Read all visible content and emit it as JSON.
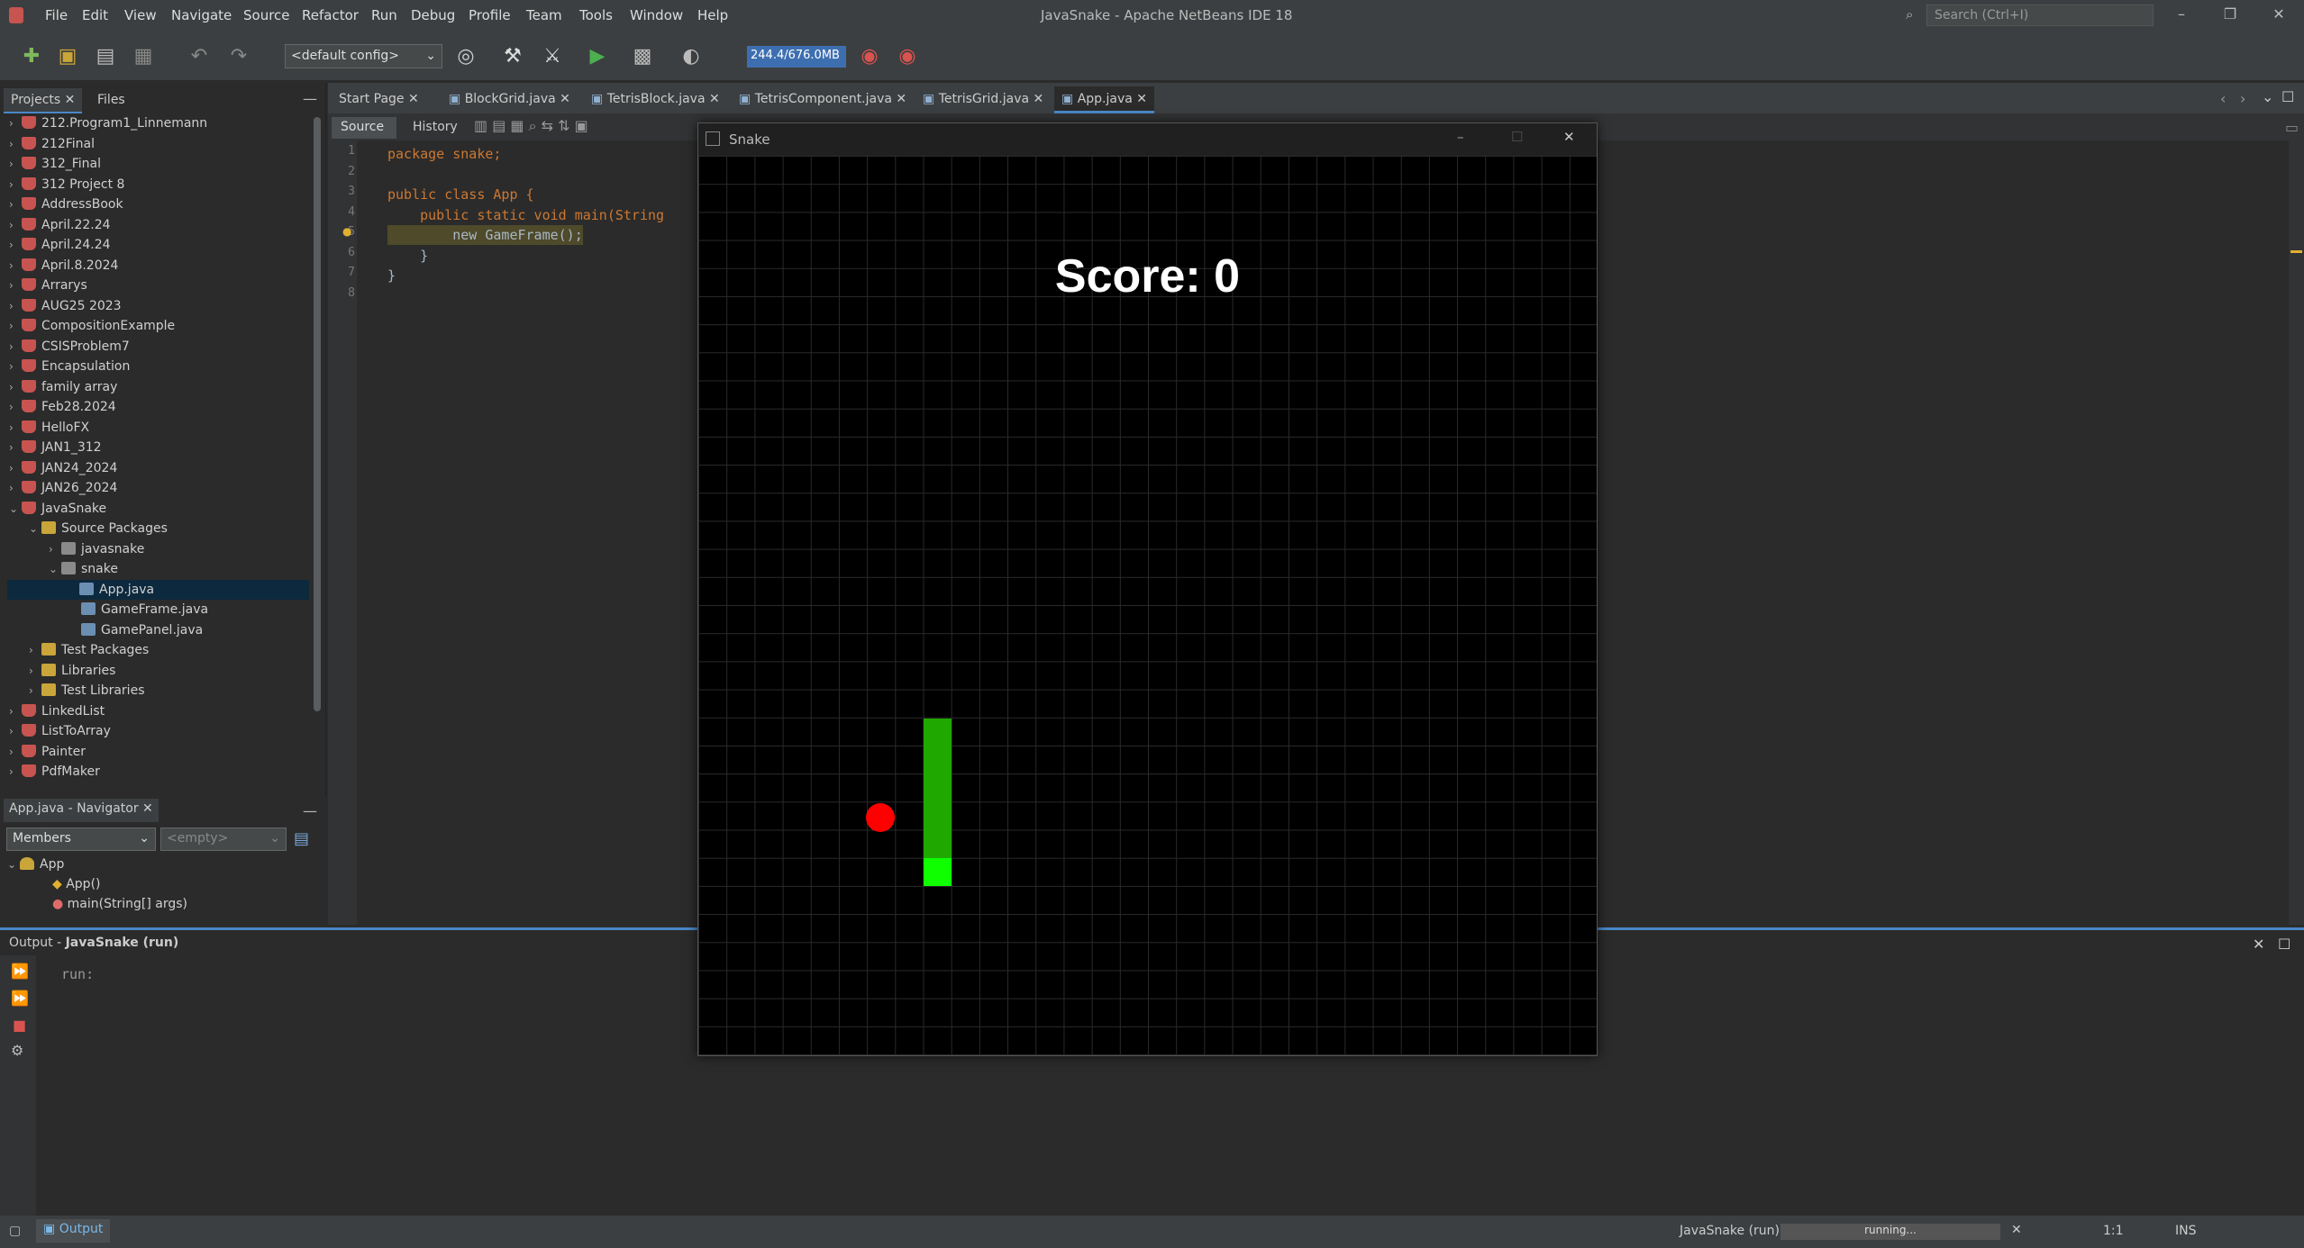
{
  "window": {
    "title": "JavaSnake - Apache NetBeans IDE 18"
  },
  "menu": [
    "File",
    "Edit",
    "View",
    "Navigate",
    "Source",
    "Refactor",
    "Run",
    "Debug",
    "Profile",
    "Team",
    "Tools",
    "Window",
    "Help"
  ],
  "search": {
    "placeholder": "Search (Ctrl+I)"
  },
  "toolbar": {
    "config": "<default config>",
    "memory": "244.4/676.0MB"
  },
  "projects_panel": {
    "tabs": [
      "Projects",
      "Files"
    ],
    "items": [
      {
        "label": "212.Program1_Linnemann",
        "icon": "project-icon"
      },
      {
        "label": "212Final",
        "icon": "project-icon"
      },
      {
        "label": "312_Final",
        "icon": "project-icon"
      },
      {
        "label": "312 Project 8",
        "icon": "project-icon"
      },
      {
        "label": "AddressBook",
        "icon": "project-icon"
      },
      {
        "label": "April.22.24",
        "icon": "project-icon"
      },
      {
        "label": "April.24.24",
        "icon": "project-icon"
      },
      {
        "label": "April.8.2024",
        "icon": "project-icon"
      },
      {
        "label": "Arrarys",
        "icon": "project-icon"
      },
      {
        "label": "AUG25 2023",
        "icon": "project-icon"
      },
      {
        "label": "CompositionExample",
        "icon": "project-icon"
      },
      {
        "label": "CSISProblem7",
        "icon": "project-icon"
      },
      {
        "label": "Encapsulation",
        "icon": "project-icon"
      },
      {
        "label": "family array",
        "icon": "project-icon"
      },
      {
        "label": "Feb28.2024",
        "icon": "project-icon"
      },
      {
        "label": "HelloFX",
        "icon": "project-icon"
      },
      {
        "label": "JAN1_312",
        "icon": "project-icon"
      },
      {
        "label": "JAN24_2024",
        "icon": "project-icon"
      },
      {
        "label": "JAN26_2024",
        "icon": "project-icon"
      },
      {
        "label": "JavaSnake",
        "icon": "project-icon"
      },
      {
        "label": "Source Packages",
        "icon": "folder-icon"
      },
      {
        "label": "javasnake",
        "icon": "package-icon"
      },
      {
        "label": "snake",
        "icon": "package-icon"
      },
      {
        "label": "App.java",
        "icon": "java-file-icon"
      },
      {
        "label": "GameFrame.java",
        "icon": "java-file-icon"
      },
      {
        "label": "GamePanel.java",
        "icon": "java-file-icon"
      },
      {
        "label": "Test Packages",
        "icon": "folder-icon"
      },
      {
        "label": "Libraries",
        "icon": "folder-icon"
      },
      {
        "label": "Test Libraries",
        "icon": "folder-icon"
      },
      {
        "label": "LinkedList",
        "icon": "project-icon"
      },
      {
        "label": "ListToArray",
        "icon": "project-icon"
      },
      {
        "label": "Painter",
        "icon": "project-icon"
      },
      {
        "label": "PdfMaker",
        "icon": "project-icon"
      }
    ]
  },
  "navigator": {
    "title": "App.java - Navigator",
    "filter": "Members",
    "filter2": "<empty>",
    "root": "App",
    "members": [
      "App()",
      "main(String[] args)"
    ]
  },
  "editor": {
    "tabs": [
      "Start Page",
      "BlockGrid.java",
      "TetrisBlock.java",
      "TetrisComponent.java",
      "TetrisGrid.java",
      "App.java"
    ],
    "view_tabs": [
      "Source",
      "History"
    ],
    "lines": [
      {
        "n": "1",
        "code": "package snake;"
      },
      {
        "n": "2",
        "code": ""
      },
      {
        "n": "3",
        "code": "public class App {"
      },
      {
        "n": "4",
        "code": "    public static void main(String"
      },
      {
        "n": "5",
        "code": "        new GameFrame();"
      },
      {
        "n": "6",
        "code": "    }"
      },
      {
        "n": "7",
        "code": "}"
      },
      {
        "n": "8",
        "code": ""
      }
    ]
  },
  "output": {
    "title_prefix": "Output - ",
    "title": "JavaSnake (run)",
    "text": "run:"
  },
  "status": {
    "tab": "Output",
    "project": "JavaSnake (run)",
    "progress": "running...",
    "position": "1:1",
    "mode": "INS"
  },
  "snake_game": {
    "title": "Snake",
    "score": "Score: 0",
    "apple_color": "#ff0000",
    "body_color": "#1fa800",
    "head_color": "#0fff00"
  }
}
